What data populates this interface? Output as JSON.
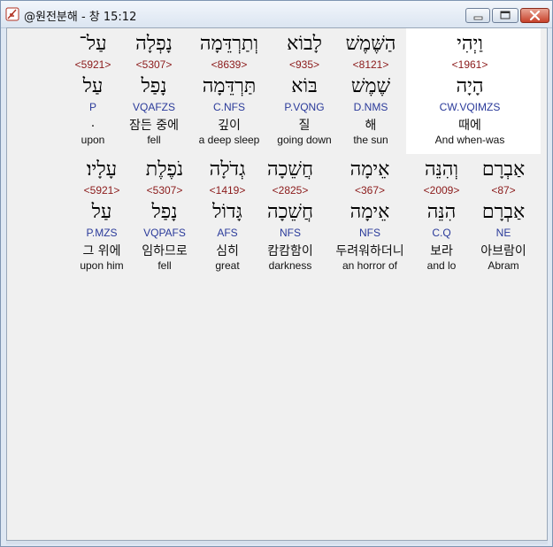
{
  "window": {
    "title": "@원전분해 - 창 15:12"
  },
  "rows": [
    {
      "words": [
        {
          "heb": "וַיְהִי",
          "num": "<1961>",
          "root": "הָיָה",
          "gram": "CW.VQIMZS",
          "kor": "때에",
          "eng": "And when-was",
          "highlighted": true
        },
        {
          "heb": "הַשֶּׁמֶשׁ",
          "num": "<8121>",
          "root": "שֶׁמֶשׁ",
          "gram": "D.NMS",
          "kor": "해",
          "eng": "the sun"
        },
        {
          "heb": "לָבוֹא",
          "num": "<935>",
          "root": "בּוֹא",
          "gram": "P.VQNG",
          "kor": "질",
          "eng": "going down"
        },
        {
          "heb": "וְתַרְדֵּמָה",
          "num": "<8639>",
          "root": "תַּרְדֵּמָה",
          "gram": "C.NFS",
          "kor": "깊이",
          "eng": "a deep sleep"
        },
        {
          "heb": "נָפְלָה",
          "num": "<5307>",
          "root": "נָפַל",
          "gram": "VQAFZS",
          "kor": "잠든 중에",
          "eng": "fell"
        },
        {
          "heb": "עַל־",
          "num": "<5921>",
          "root": "עַל",
          "gram": "P",
          "kor": ".",
          "eng": "upon"
        }
      ]
    },
    {
      "words": [
        {
          "heb": "אַבְרָם",
          "num": "<87>",
          "root": "אַבְרָם",
          "gram": "NE",
          "kor": "아브람이",
          "eng": "Abram"
        },
        {
          "heb": "וְהִנֵּה",
          "num": "<2009>",
          "root": "הִנֵּה",
          "gram": "C.Q",
          "kor": "보라",
          "eng": "and lo"
        },
        {
          "heb": "אֵימָה",
          "num": "<367>",
          "root": "אֵימָה",
          "gram": "NFS",
          "kor": "두려워하더니",
          "eng": "an horror of"
        },
        {
          "heb": "חֲשֵׁכָה",
          "num": "<2825>",
          "root": "חֲשֵׁכָה",
          "gram": "NFS",
          "kor": "캄캄함이",
          "eng": "darkness"
        },
        {
          "heb": "גְדֹלָה",
          "num": "<1419>",
          "root": "גָּדוֹל",
          "gram": "AFS",
          "kor": "심히",
          "eng": "great"
        },
        {
          "heb": "נֹפֶלֶת",
          "num": "<5307>",
          "root": "נָפַל",
          "gram": "VQPAFS",
          "kor": "임하므로",
          "eng": "fell"
        },
        {
          "heb": "עָלָיו׃",
          "num": "<5921>",
          "root": "עַל",
          "gram": "P.MZS",
          "kor": "그 위에",
          "eng": "upon him"
        }
      ]
    }
  ],
  "colors": {
    "strong_number": "#8b1a1a",
    "grammar_code": "#2a3a9a",
    "highlight_bg": "#ffffff"
  },
  "icons": {
    "app": "app-feather-icon",
    "minimize": "minimize-icon",
    "maximize": "maximize-icon",
    "close": "close-icon"
  }
}
